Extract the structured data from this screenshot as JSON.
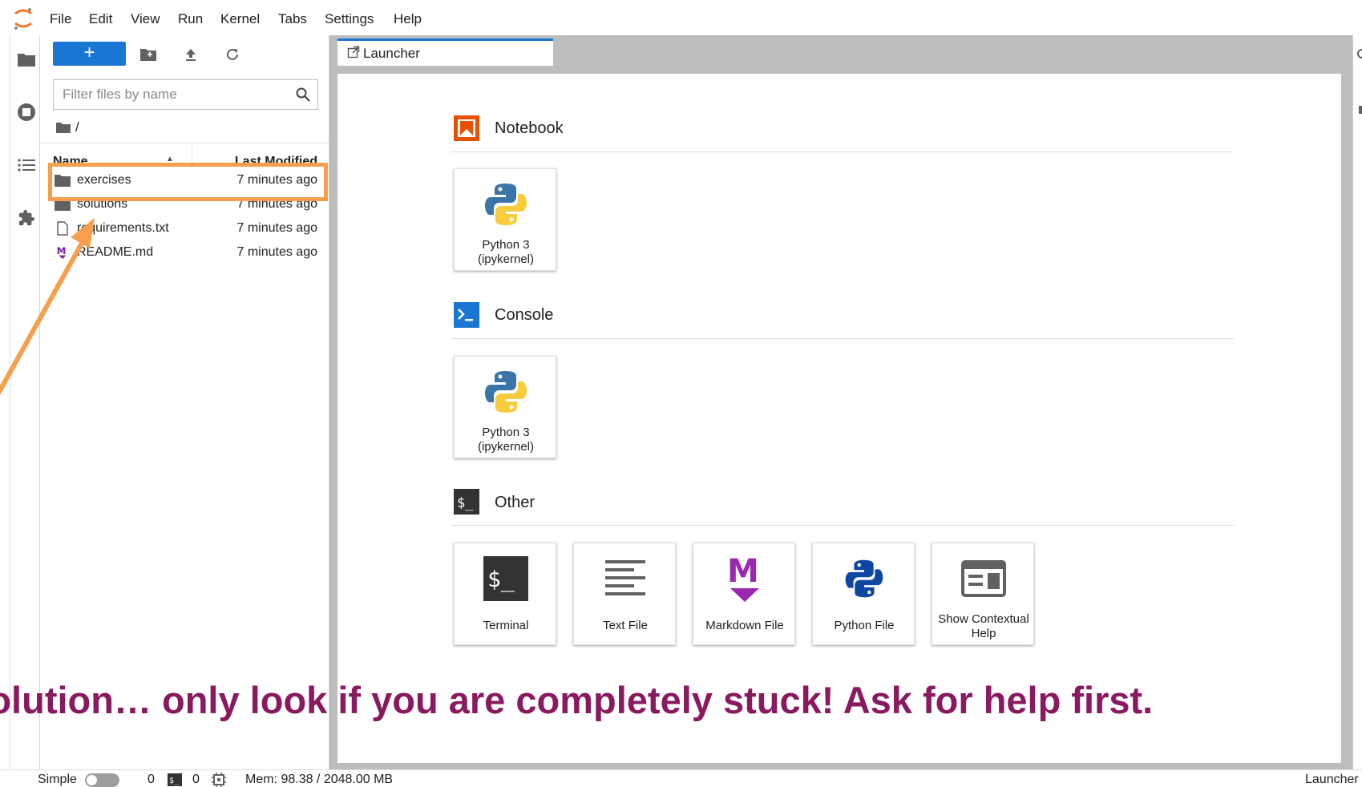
{
  "menubar": {
    "items": [
      "File",
      "Edit",
      "View",
      "Run",
      "Kernel",
      "Tabs",
      "Settings",
      "Help"
    ]
  },
  "activity": {
    "icons": [
      "folder-icon",
      "running-icon",
      "toc-icon",
      "extension-icon"
    ]
  },
  "filebrowser": {
    "new_label": "+",
    "filter_placeholder": "Filter files by name",
    "breadcrumb": "/",
    "columns": {
      "name": "Name",
      "modified": "Last Modified"
    },
    "files": [
      {
        "name": "exercises",
        "modified": "7 minutes ago",
        "icon": "folder-icon"
      },
      {
        "name": "solutions",
        "modified": "7 minutes ago",
        "icon": "folder-icon"
      },
      {
        "name": "requirements.txt",
        "modified": "7 minutes ago",
        "icon": "file-icon"
      },
      {
        "name": "README.md",
        "modified": "7 minutes ago",
        "icon": "markdown-icon"
      }
    ]
  },
  "tab": {
    "label": "Launcher"
  },
  "launcher": {
    "sections": {
      "notebook": {
        "title": "Notebook",
        "cards": [
          {
            "label": "Python 3 (ipykernel)"
          }
        ]
      },
      "console": {
        "title": "Console",
        "cards": [
          {
            "label": "Python 3 (ipykernel)"
          }
        ]
      },
      "other": {
        "title": "Other",
        "cards": [
          {
            "label": "Terminal"
          },
          {
            "label": "Text File"
          },
          {
            "label": "Markdown File"
          },
          {
            "label": "Python File"
          },
          {
            "label": "Show Contextual Help"
          }
        ]
      }
    }
  },
  "statusbar": {
    "mode_label": "Simple",
    "terminals_count": "0",
    "kernels_count": "0",
    "memory": "Mem: 98.38 / 2048.00 MB",
    "right_label": "Launcher"
  },
  "annotation": {
    "caption": "Solution… only look if you are completely stuck! Ask for help first.",
    "colors": {
      "highlight": "#f6a04d",
      "caption": "#8a1a5f"
    }
  },
  "colors": {
    "accent": "#1976d2",
    "notebook": "#e65100",
    "terminal": "#333333",
    "markdown": "#7b1fa2"
  }
}
